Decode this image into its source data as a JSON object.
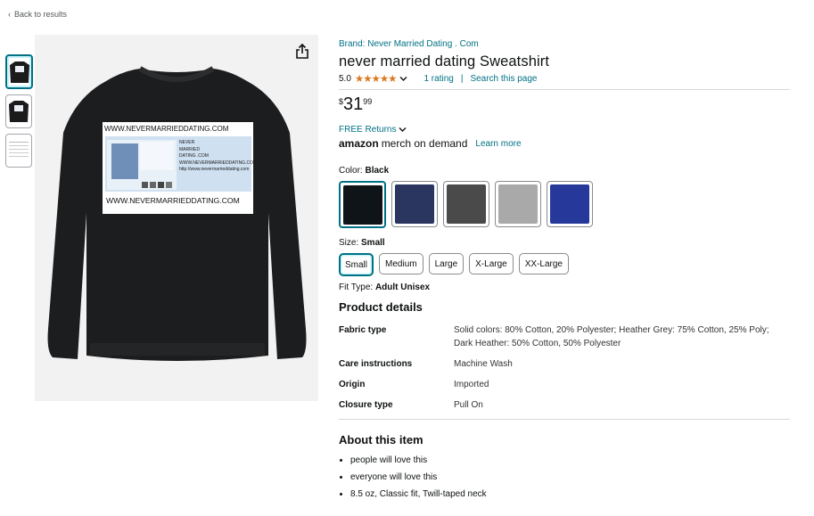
{
  "nav": {
    "back_label": "Back to results"
  },
  "product": {
    "brand": "Brand: Never Married Dating . Com",
    "title": "never married dating Sweatshirt",
    "rating_value": "5.0",
    "stars": 5,
    "rating_count": "1 rating",
    "search_page": "Search this page",
    "price": {
      "symbol": "$",
      "whole": "31",
      "fraction": "99"
    },
    "returns_label": "FREE Returns",
    "merch_brand": "amazon",
    "merch_suffix": "merch on demand",
    "learn_more": "Learn more",
    "shirt_print": {
      "url_top": "WWW.NEVERMARRIEDDATING.COM",
      "url_bottom": "WWW.NEVERMARRIEDDATING.COM",
      "lines": [
        "NEVER",
        "MARRIED",
        "DATING .COM",
        "WWW.NEVERMARRIEDDATING.COM",
        "http://www.nevermarrieddating.com"
      ]
    }
  },
  "color": {
    "label": "Color:",
    "selected": "Black",
    "swatches": [
      {
        "name": "Black",
        "hex": "#0f1418"
      },
      {
        "name": "Navy",
        "hex": "#2a3560"
      },
      {
        "name": "Dark Heather",
        "hex": "#4a4a4a"
      },
      {
        "name": "Heather Grey",
        "hex": "#a9a9a9"
      },
      {
        "name": "Royal Blue",
        "hex": "#26399a"
      }
    ]
  },
  "size": {
    "label": "Size:",
    "selected": "Small",
    "options": [
      "Small",
      "Medium",
      "Large",
      "X-Large",
      "XX-Large"
    ]
  },
  "fit": {
    "label": "Fit Type:",
    "value": "Adult Unisex"
  },
  "details": {
    "heading": "Product details",
    "rows": [
      {
        "key": "Fabric type",
        "value": "Solid colors: 80% Cotton, 20% Polyester; Heather Grey: 75% Cotton, 25% Poly; Dark Heather: 50% Cotton, 50% Polyester"
      },
      {
        "key": "Care instructions",
        "value": "Machine Wash"
      },
      {
        "key": "Origin",
        "value": "Imported"
      },
      {
        "key": "Closure type",
        "value": "Pull On"
      }
    ]
  },
  "about": {
    "heading": "About this item",
    "bullets": [
      "people will love this",
      "everyone will love this",
      "8.5 oz, Classic fit, Twill-taped neck"
    ]
  },
  "icons": {
    "share": "share-icon",
    "chevron": "chevron-down-icon"
  },
  "colors_ui": {
    "link": "#007185",
    "star": "#de7921",
    "selected_border": "#007185"
  }
}
